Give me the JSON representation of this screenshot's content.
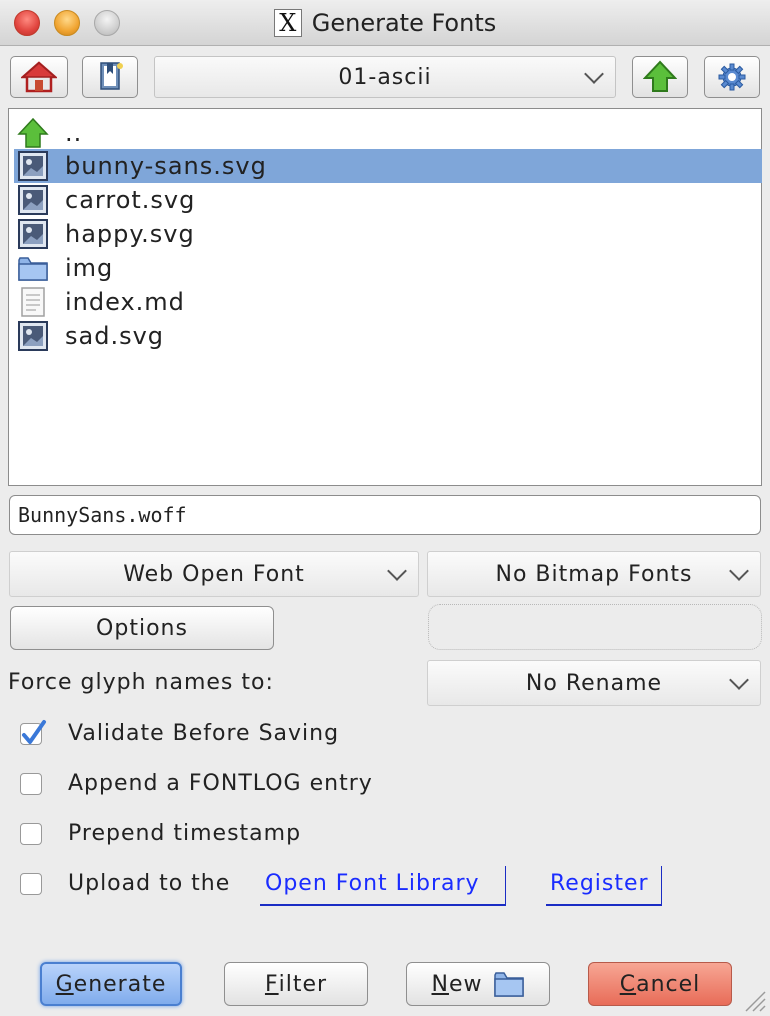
{
  "window": {
    "title": "Generate Fonts",
    "app_glyph": "X"
  },
  "toolbar": {
    "home_icon": "home-icon",
    "bookmarks_icon": "bookmarks-icon",
    "directory": "01-ascii",
    "up_icon": "up-arrow-icon",
    "settings_icon": "gear-icon"
  },
  "files": [
    {
      "name": "..",
      "icon": "parent-dir-icon",
      "selected": false
    },
    {
      "name": "bunny-sans.svg",
      "icon": "image-file-icon",
      "selected": true
    },
    {
      "name": "carrot.svg",
      "icon": "image-file-icon",
      "selected": false
    },
    {
      "name": "happy.svg",
      "icon": "image-file-icon",
      "selected": false
    },
    {
      "name": "img",
      "icon": "folder-icon",
      "selected": false
    },
    {
      "name": "index.md",
      "icon": "text-file-icon",
      "selected": false
    },
    {
      "name": "sad.svg",
      "icon": "image-file-icon",
      "selected": false
    }
  ],
  "filename": "BunnySans.woff",
  "format_select": "Web Open Font",
  "bitmap_select": "No Bitmap Fonts",
  "options_label": "Options",
  "glyph_names": {
    "label": "Force glyph names to:",
    "value": "No Rename"
  },
  "checkboxes": [
    {
      "label": "Validate Before Saving",
      "checked": true
    },
    {
      "label": "Append a FONTLOG entry",
      "checked": false
    },
    {
      "label": "Prepend timestamp",
      "checked": false
    },
    {
      "label": "Upload to the",
      "checked": false
    }
  ],
  "links": {
    "library": "Open Font Library",
    "register": "Register"
  },
  "buttons": {
    "generate": {
      "mnemonic": "G",
      "rest": "enerate"
    },
    "filter": {
      "mnemonic": "F",
      "rest": "ilter"
    },
    "new": {
      "mnemonic": "N",
      "rest": "ew"
    },
    "cancel": {
      "mnemonic": "C",
      "rest": "ancel"
    }
  },
  "colors": {
    "selection": "#7fa6d9",
    "default_button": "#80acec",
    "cancel_button": "#e86c58",
    "link": "#1a2cff"
  }
}
